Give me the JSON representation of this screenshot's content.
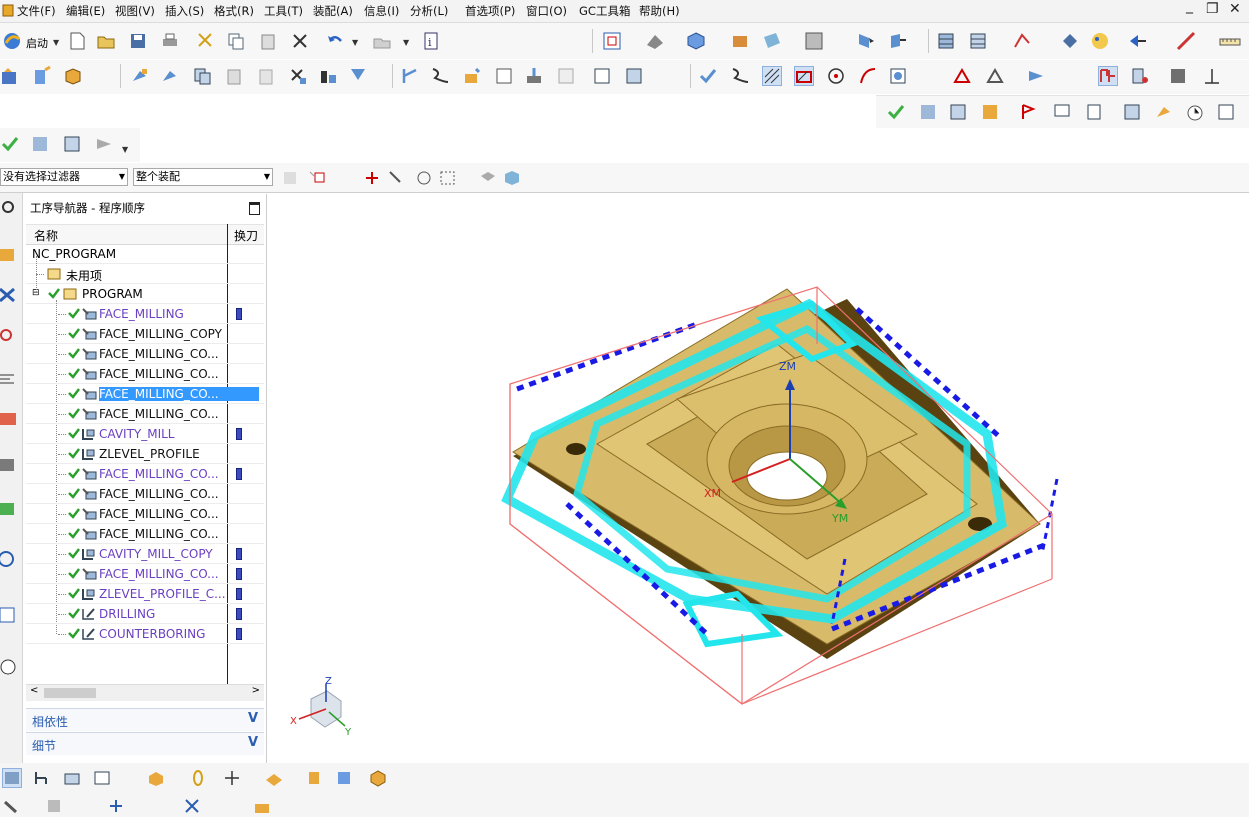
{
  "menu": {
    "items": [
      "文件(F)",
      "编辑(E)",
      "视图(V)",
      "插入(S)",
      "格式(R)",
      "工具(T)",
      "装配(A)",
      "信息(I)",
      "分析(L)",
      "首选项(P)",
      "窗口(O)",
      "GC工具箱",
      "帮助(H)"
    ],
    "window_controls": [
      "_",
      "❐",
      "✕"
    ]
  },
  "toolbar": {
    "start_label": "启动"
  },
  "filter": {
    "selection_filter": "没有选择过滤器",
    "assembly_scope": "整个装配"
  },
  "navigator": {
    "title": "工序导航器 - 程序顺序",
    "col_name": "名称",
    "col_tool": "换刀",
    "root": "NC_PROGRAM",
    "unused": "未用项",
    "program": "PROGRAM",
    "operations": [
      {
        "name": "FACE_MILLING",
        "type": "face",
        "highlight": true,
        "tool_change": true,
        "selected": false
      },
      {
        "name": "FACE_MILLING_COPY",
        "type": "face",
        "highlight": false,
        "tool_change": false,
        "selected": false
      },
      {
        "name": "FACE_MILLING_CO...",
        "type": "face",
        "highlight": false,
        "tool_change": false,
        "selected": false
      },
      {
        "name": "FACE_MILLING_CO...",
        "type": "face",
        "highlight": false,
        "tool_change": false,
        "selected": false
      },
      {
        "name": "FACE_MILLING_CO...",
        "type": "face",
        "highlight": false,
        "tool_change": false,
        "selected": true
      },
      {
        "name": "FACE_MILLING_CO...",
        "type": "face",
        "highlight": false,
        "tool_change": false,
        "selected": false
      },
      {
        "name": "CAVITY_MILL",
        "type": "cavity",
        "highlight": true,
        "tool_change": true,
        "selected": false
      },
      {
        "name": "ZLEVEL_PROFILE",
        "type": "cavity",
        "highlight": false,
        "tool_change": false,
        "selected": false
      },
      {
        "name": "FACE_MILLING_CO...",
        "type": "face",
        "highlight": true,
        "tool_change": true,
        "selected": false
      },
      {
        "name": "FACE_MILLING_CO...",
        "type": "face",
        "highlight": false,
        "tool_change": false,
        "selected": false
      },
      {
        "name": "FACE_MILLING_CO...",
        "type": "face",
        "highlight": false,
        "tool_change": false,
        "selected": false
      },
      {
        "name": "FACE_MILLING_CO...",
        "type": "face",
        "highlight": false,
        "tool_change": false,
        "selected": false
      },
      {
        "name": "CAVITY_MILL_COPY",
        "type": "cavity",
        "highlight": true,
        "tool_change": true,
        "selected": false
      },
      {
        "name": "FACE_MILLING_CO...",
        "type": "face",
        "highlight": true,
        "tool_change": true,
        "selected": false
      },
      {
        "name": "ZLEVEL_PROFILE_C...",
        "type": "cavity",
        "highlight": true,
        "tool_change": true,
        "selected": false
      },
      {
        "name": "DRILLING",
        "type": "drill",
        "highlight": true,
        "tool_change": true,
        "selected": false
      },
      {
        "name": "COUNTERBORING",
        "type": "drill",
        "highlight": true,
        "tool_change": true,
        "selected": false
      }
    ],
    "sections": [
      "相依性",
      "细节"
    ]
  },
  "viewport": {
    "axis_labels": {
      "zm": "ZM",
      "xm": "XM",
      "ym": "YM"
    },
    "triad_labels": {
      "x": "X",
      "y": "Y",
      "z": "Z"
    }
  },
  "colors": {
    "part": "#d8bb6a",
    "part_dark": "#6e5417",
    "toolpath": "#22e6ec",
    "rapid": "#1a1ae6",
    "bounding": "#f07070",
    "selection": "#3399ff",
    "link": "#6a3fc0"
  }
}
